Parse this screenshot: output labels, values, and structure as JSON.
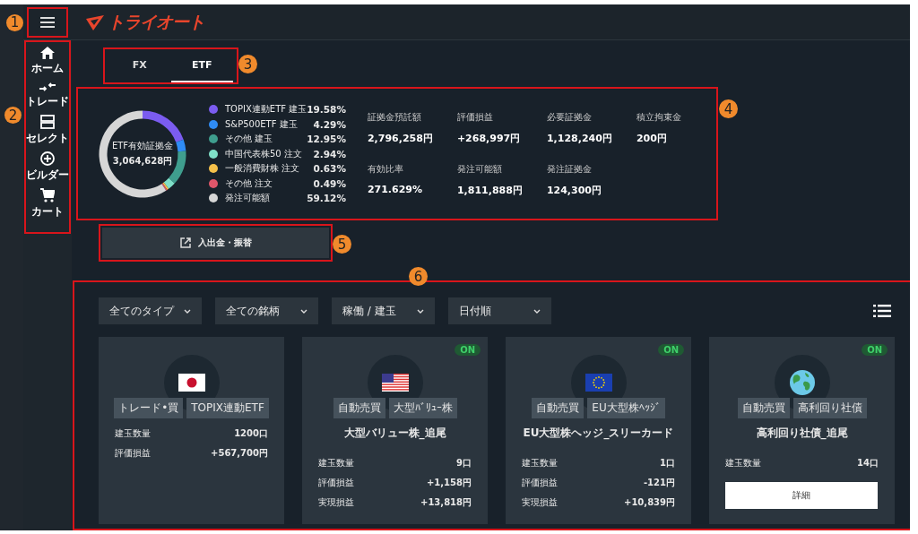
{
  "callouts": [
    {
      "number": "1"
    },
    {
      "number": "2"
    },
    {
      "number": "3"
    },
    {
      "number": "4"
    },
    {
      "number": "5"
    },
    {
      "number": "6"
    }
  ],
  "header": {
    "logo": "トライオート"
  },
  "sidebar": {
    "items": [
      {
        "label": "ホーム"
      },
      {
        "label": "トレード"
      },
      {
        "label": "セレクト"
      },
      {
        "label": "ビルダー"
      },
      {
        "label": "カート"
      }
    ]
  },
  "tabs": [
    {
      "label": "FX",
      "selected": false
    },
    {
      "label": "ETF",
      "selected": true
    }
  ],
  "summary": {
    "center_label": "ETF有効証拠金",
    "center_value": "3,064,628円",
    "legend": [
      {
        "percent": "19.58%",
        "color": "#7b5cf0"
      },
      {
        "percent": "4.29%",
        "color": "#2f8cf5"
      },
      {
        "percent": "12.95%",
        "color": "#3f9e8e"
      },
      {
        "percent": "2.94%",
        "color": "#7fe0c8"
      },
      {
        "percent": "0.63%",
        "color": "#f5c04a"
      },
      {
        "percent": "0.49%",
        "color": "#e0566a"
      },
      {
        "percent": "59.12%",
        "color": "#d6d6d6"
      }
    ],
    "chart_data": {
      "type": "donut",
      "categories": [
        "TOPIX連動ETF 建玉",
        "S&P500ETF 建玉",
        "その他 建玉",
        "中国代表株50 注文",
        "一般消費財株 注文",
        "その他 注文",
        "発注可能額"
      ],
      "values": [
        19.58,
        4.29,
        12.95,
        2.94,
        0.63,
        0.49,
        59.12
      ]
    },
    "stats": [
      {
        "label": "証拠金預託額",
        "value": "2,796,258円"
      },
      {
        "label": "評価損益",
        "value": "+268,997円"
      },
      {
        "label": "必要証拠金",
        "value": "1,128,240円"
      },
      {
        "label": "積立拘束金",
        "value": "200円"
      },
      {
        "label": "有効比率",
        "value": "271.629%"
      },
      {
        "label": "発注可能額",
        "value": "1,811,888円"
      },
      {
        "label": "発注証拠金",
        "value": "124,300円"
      }
    ]
  },
  "transfer_button": {
    "label": "入出金・振替"
  },
  "filters": [
    {
      "label": "全てのタイプ"
    },
    {
      "label": "全ての銘柄"
    },
    {
      "label": "稼働 / 建玉"
    },
    {
      "label": "日付順"
    }
  ],
  "cards": [
    {
      "on": false,
      "tags": [
        "トレード•買",
        "TOPIX連動ETF"
      ],
      "stats": [
        {
          "label": "建玉数量",
          "value": "1200口"
        },
        {
          "label": "評価損益",
          "value": "+567,700円"
        }
      ]
    },
    {
      "on": true,
      "on_label": "ON",
      "tags": [
        "自動売買",
        "大型ﾊﾞﾘｭｰ株"
      ],
      "title": "大型バリュー株_追尾",
      "stats": [
        {
          "label": "建玉数量",
          "value": "9口"
        },
        {
          "label": "評価損益",
          "value": "+1,158円"
        },
        {
          "label": "実現損益",
          "value": "+13,818円"
        }
      ]
    },
    {
      "on": true,
      "on_label": "ON",
      "tags": [
        "自動売買",
        "EU大型株ﾍｯｼﾞ"
      ],
      "title": "EU大型株ヘッジ_スリーカード",
      "stats": [
        {
          "label": "建玉数量",
          "value": "1口"
        },
        {
          "label": "評価損益",
          "value": "-121円"
        },
        {
          "label": "実現損益",
          "value": "+10,839円"
        }
      ]
    },
    {
      "on": true,
      "on_label": "ON",
      "tags": [
        "自動売買",
        "高利回り社債"
      ],
      "title": "高利回り社債_追尾",
      "stats": [
        {
          "label": "建玉数量",
          "value": "14口"
        }
      ],
      "popup": "詳細"
    }
  ]
}
